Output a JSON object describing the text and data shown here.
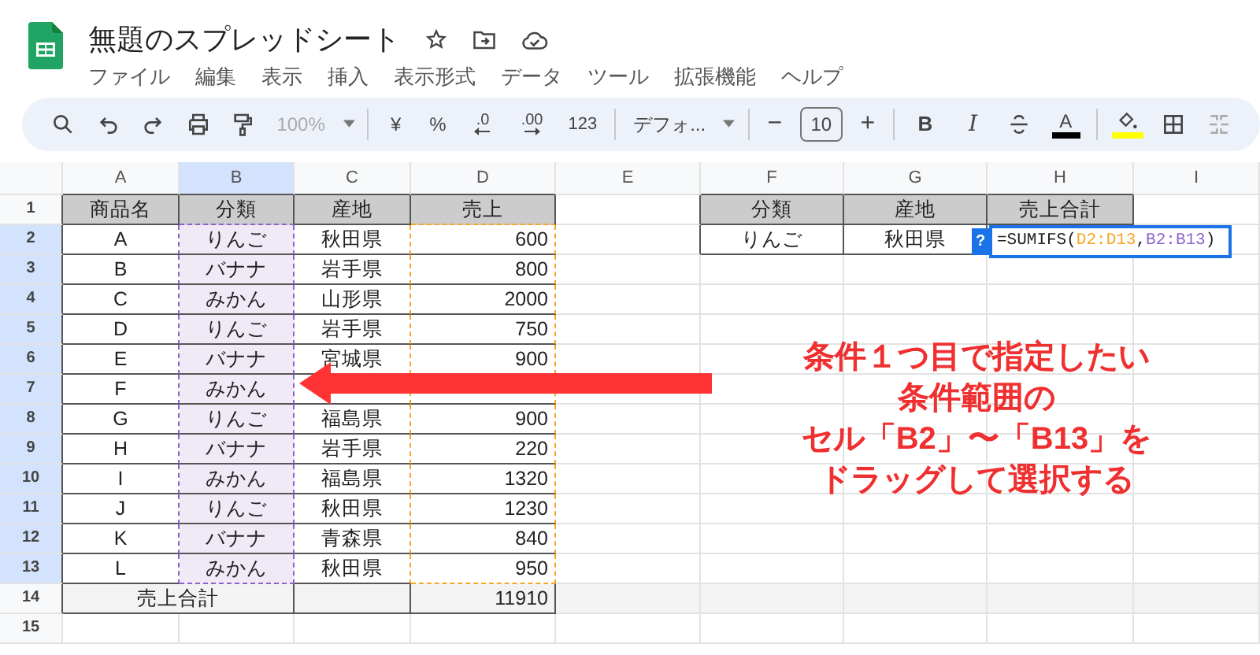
{
  "app": {
    "title": "無題のスプレッドシート",
    "menu": [
      "ファイル",
      "編集",
      "表示",
      "挿入",
      "表示形式",
      "データ",
      "ツール",
      "拡張機能",
      "ヘルプ"
    ]
  },
  "toolbar": {
    "zoom": {
      "text": "100%",
      "disabled": true
    },
    "currency": "¥",
    "percent": "%",
    "decimal_decrease": ".0",
    "decimal_increase": ".00",
    "number_format": "123",
    "font": "デフォ...",
    "minus": "−",
    "font_size": "10",
    "plus": "+",
    "bold": "B",
    "italic": "I",
    "text_color": "A"
  },
  "columns": [
    {
      "label": "A",
      "selected": false
    },
    {
      "label": "B",
      "selected": true
    },
    {
      "label": "C",
      "selected": false
    },
    {
      "label": "D",
      "selected": false
    },
    {
      "label": "E",
      "selected": false
    },
    {
      "label": "F",
      "selected": false
    },
    {
      "label": "G",
      "selected": false
    },
    {
      "label": "H",
      "selected": false
    },
    {
      "label": "I",
      "selected": false
    }
  ],
  "rows": [
    {
      "number": "1",
      "selected": false,
      "kind": "header",
      "cells": {
        "A": "商品名",
        "B": "分類",
        "C": "産地",
        "D": "売上",
        "F": "分類",
        "G": "産地",
        "H": "売上合計"
      }
    },
    {
      "number": "2",
      "selected": true,
      "kind": "data",
      "cells": {
        "A": "A",
        "B": "りんご",
        "C": "秋田県",
        "D": "600",
        "F": "りんご",
        "G": "秋田県"
      }
    },
    {
      "number": "3",
      "selected": true,
      "kind": "data",
      "cells": {
        "A": "B",
        "B": "バナナ",
        "C": "岩手県",
        "D": "800"
      }
    },
    {
      "number": "4",
      "selected": true,
      "kind": "data",
      "cells": {
        "A": "C",
        "B": "みかん",
        "C": "山形県",
        "D": "2000"
      }
    },
    {
      "number": "5",
      "selected": true,
      "kind": "data",
      "cells": {
        "A": "D",
        "B": "りんご",
        "C": "岩手県",
        "D": "750"
      }
    },
    {
      "number": "6",
      "selected": true,
      "kind": "data",
      "cells": {
        "A": "E",
        "B": "バナナ",
        "C": "宮城県",
        "D": "900"
      }
    },
    {
      "number": "7",
      "selected": true,
      "kind": "data",
      "cells": {
        "A": "F",
        "B": "みかん"
      }
    },
    {
      "number": "8",
      "selected": true,
      "kind": "data",
      "cells": {
        "A": "G",
        "B": "りんご",
        "C": "福島県",
        "D": "900"
      }
    },
    {
      "number": "9",
      "selected": true,
      "kind": "data",
      "cells": {
        "A": "H",
        "B": "バナナ",
        "C": "岩手県",
        "D": "220"
      }
    },
    {
      "number": "10",
      "selected": true,
      "kind": "data",
      "cells": {
        "A": "I",
        "B": "みかん",
        "C": "福島県",
        "D": "1320"
      }
    },
    {
      "number": "11",
      "selected": true,
      "kind": "data",
      "cells": {
        "A": "J",
        "B": "りんご",
        "C": "秋田県",
        "D": "1230"
      }
    },
    {
      "number": "12",
      "selected": true,
      "kind": "data",
      "cells": {
        "A": "K",
        "B": "バナナ",
        "C": "青森県",
        "D": "840"
      }
    },
    {
      "number": "13",
      "selected": true,
      "kind": "data",
      "cells": {
        "A": "L",
        "B": "みかん",
        "C": "秋田県",
        "D": "950"
      }
    },
    {
      "number": "14",
      "selected": false,
      "kind": "total",
      "cells": {
        "A": "売上合計",
        "D": "11910"
      }
    },
    {
      "number": "15",
      "selected": false,
      "kind": "blank",
      "cells": {}
    }
  ],
  "formula_editor": {
    "hint": "?",
    "parts": [
      {
        "text": "=SUMIFS(",
        "kind": "plain"
      },
      {
        "text": "D2:D13",
        "kind": "range",
        "color": "#f5a623"
      },
      {
        "text": ",",
        "kind": "plain"
      },
      {
        "text": "B2:B13",
        "kind": "range",
        "color": "#8e63ce"
      },
      {
        "text": ")",
        "kind": "plain"
      }
    ]
  },
  "callout": {
    "lines": [
      "条件１つ目で指定したい",
      "条件範囲の",
      "セル「B2」〜「B13」を",
      "ドラッグして選択する"
    ]
  }
}
